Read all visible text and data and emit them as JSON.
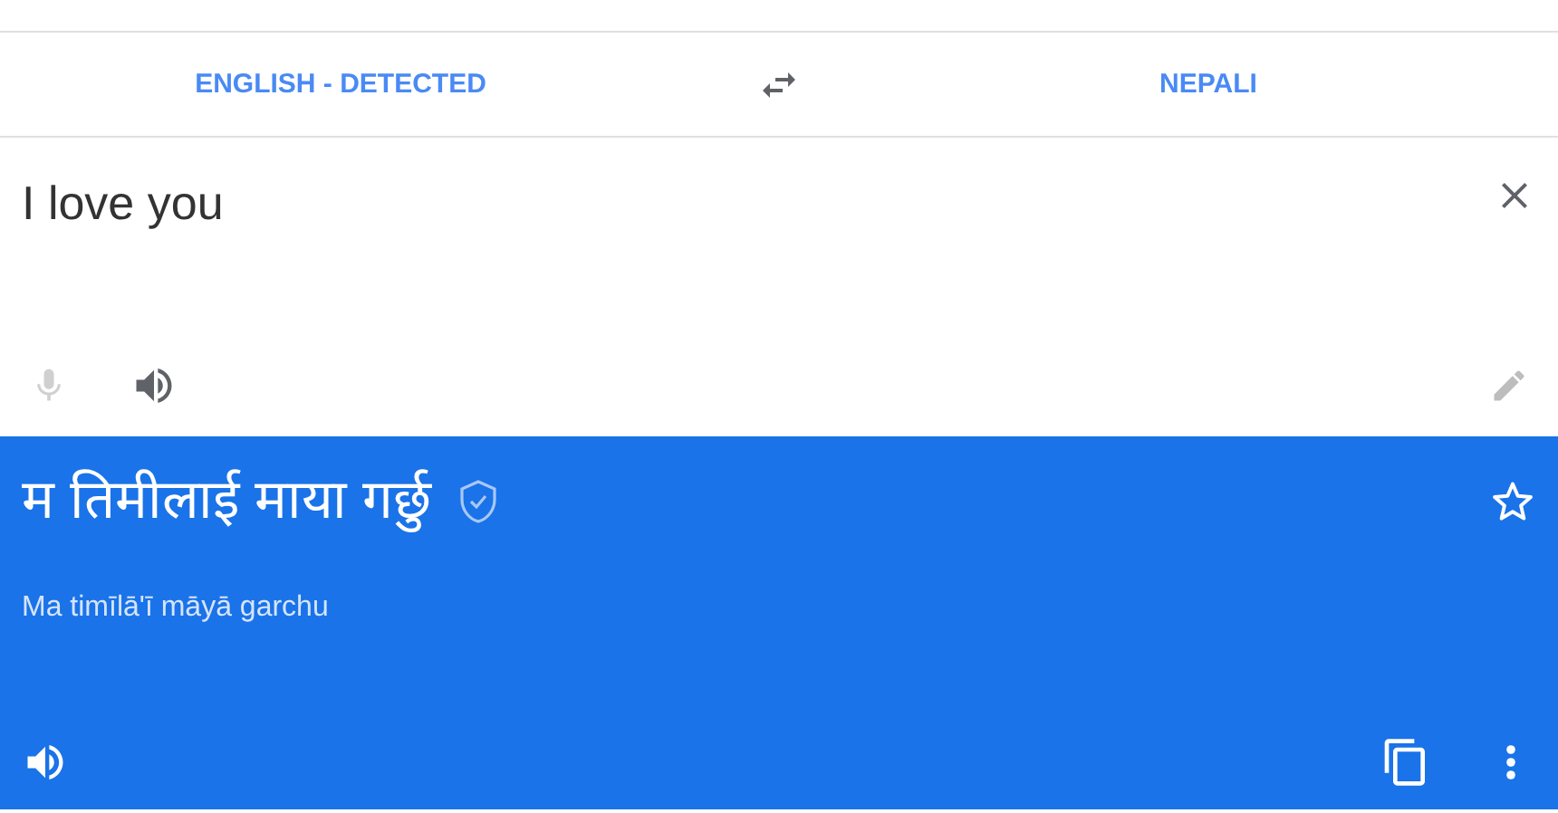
{
  "languages": {
    "source": "ENGLISH - DETECTED",
    "target": "NEPALI"
  },
  "input": {
    "value": "I love you",
    "mic_disabled": true
  },
  "translation": {
    "text": "म तिमीलाई माया गर्छु",
    "verified": true,
    "starred": false,
    "transliteration": "Ma timīlā'ī māyā garchu"
  }
}
